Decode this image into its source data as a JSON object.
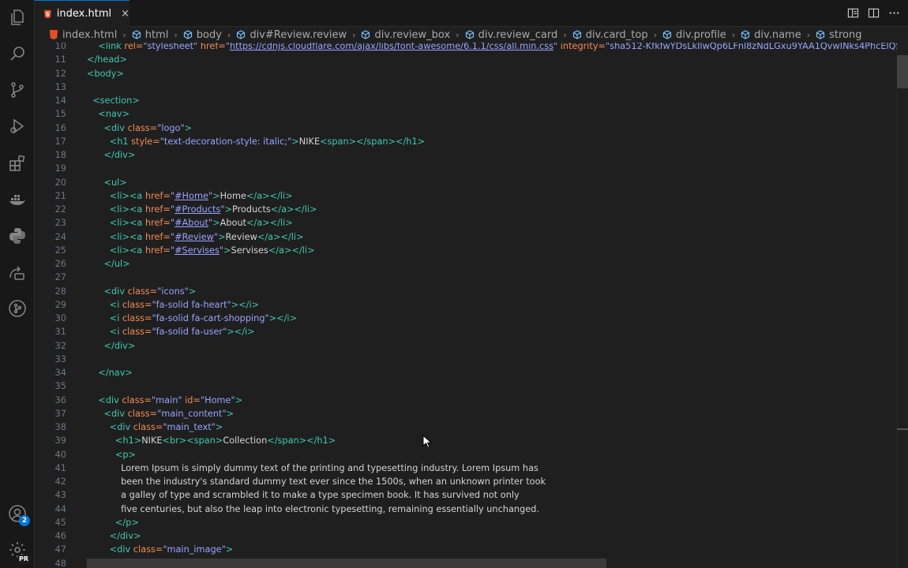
{
  "activity_bar": {
    "items": [
      "explorer-icon",
      "search-icon",
      "source-control-icon",
      "run-debug-icon",
      "extensions-icon",
      "docker-icon",
      "python-icon",
      "remote-explorer-icon",
      "gitlens-icon"
    ],
    "accounts_badge": "2",
    "settings_badge": "PR"
  },
  "tabs": [
    {
      "label": "index.html",
      "close": "×"
    }
  ],
  "breadcrumb": [
    "index.html",
    "html",
    "body",
    "div#Review.review",
    "div.review_box",
    "div.review_card",
    "div.card_top",
    "div.profile",
    "div.name",
    "strong"
  ],
  "editor": {
    "line_numbers": [
      "10",
      "11",
      "12",
      "13",
      "14",
      "15",
      "16",
      "17",
      "18",
      "19",
      "20",
      "21",
      "22",
      "23",
      "24",
      "25",
      "26",
      "27",
      "28",
      "29",
      "30",
      "31",
      "32",
      "33",
      "34",
      "35",
      "36",
      "37",
      "38",
      "39",
      "40",
      "41",
      "42",
      "43",
      "44",
      "45",
      "46",
      "47",
      "48"
    ],
    "lines": [
      [
        {
          "t": "    "
        },
        {
          "c": "tag",
          "t": "<link "
        },
        {
          "c": "attr",
          "t": "rel="
        },
        {
          "c": "val",
          "t": "\"stylesheet\" "
        },
        {
          "c": "attr",
          "t": "href="
        },
        {
          "c": "val",
          "t": "\""
        },
        {
          "c": "link",
          "t": "https://cdnjs.cloudflare.com/ajax/libs/font-awesome/6.1.1/css/all.min.css"
        },
        {
          "c": "val",
          "t": "\" "
        },
        {
          "c": "attr",
          "t": "integrity="
        },
        {
          "c": "val",
          "t": "\"sha512-KfkfwYDsLkIlwQp6LFnl8zNdLGxu9YAA1QvwINks4PhcElQSvqcyVLLD"
        }
      ],
      [
        {
          "c": "tag",
          "t": "</head>"
        }
      ],
      [
        {
          "c": "tag",
          "t": "<body>"
        }
      ],
      [],
      [
        {
          "t": "  "
        },
        {
          "c": "tag",
          "t": "<section>"
        }
      ],
      [
        {
          "t": "    "
        },
        {
          "c": "tag",
          "t": "<nav>"
        }
      ],
      [
        {
          "t": "      "
        },
        {
          "c": "tag",
          "t": "<div "
        },
        {
          "c": "attr",
          "t": "class="
        },
        {
          "c": "val",
          "t": "\"logo\""
        },
        {
          "c": "tag",
          "t": ">"
        }
      ],
      [
        {
          "t": "        "
        },
        {
          "c": "tag",
          "t": "<h1 "
        },
        {
          "c": "attr",
          "t": "style="
        },
        {
          "c": "val",
          "t": "\"text-decoration-style: italic;\""
        },
        {
          "c": "tag",
          "t": ">"
        },
        {
          "c": "txt",
          "t": "NIKE"
        },
        {
          "c": "tag",
          "t": "<span></span></h1>"
        }
      ],
      [
        {
          "t": "      "
        },
        {
          "c": "tag",
          "t": "</div>"
        }
      ],
      [],
      [
        {
          "t": "      "
        },
        {
          "c": "tag",
          "t": "<ul>"
        }
      ],
      [
        {
          "t": "        "
        },
        {
          "c": "tag",
          "t": "<li><a "
        },
        {
          "c": "attr",
          "t": "href="
        },
        {
          "c": "val",
          "t": "\""
        },
        {
          "c": "link",
          "t": "#Home"
        },
        {
          "c": "val",
          "t": "\""
        },
        {
          "c": "tag",
          "t": ">"
        },
        {
          "c": "txt",
          "t": "Home"
        },
        {
          "c": "tag",
          "t": "</a></li>"
        }
      ],
      [
        {
          "t": "        "
        },
        {
          "c": "tag",
          "t": "<li><a "
        },
        {
          "c": "attr",
          "t": "href="
        },
        {
          "c": "val",
          "t": "\""
        },
        {
          "c": "link",
          "t": "#Products"
        },
        {
          "c": "val",
          "t": "\""
        },
        {
          "c": "tag",
          "t": ">"
        },
        {
          "c": "txt",
          "t": "Products"
        },
        {
          "c": "tag",
          "t": "</a></li>"
        }
      ],
      [
        {
          "t": "        "
        },
        {
          "c": "tag",
          "t": "<li><a "
        },
        {
          "c": "attr",
          "t": "href="
        },
        {
          "c": "val",
          "t": "\""
        },
        {
          "c": "link",
          "t": "#About"
        },
        {
          "c": "val",
          "t": "\""
        },
        {
          "c": "tag",
          "t": ">"
        },
        {
          "c": "txt",
          "t": "About"
        },
        {
          "c": "tag",
          "t": "</a></li>"
        }
      ],
      [
        {
          "t": "        "
        },
        {
          "c": "tag",
          "t": "<li><a "
        },
        {
          "c": "attr",
          "t": "href="
        },
        {
          "c": "val",
          "t": "\""
        },
        {
          "c": "link",
          "t": "#Review"
        },
        {
          "c": "val",
          "t": "\""
        },
        {
          "c": "tag",
          "t": ">"
        },
        {
          "c": "txt",
          "t": "Review"
        },
        {
          "c": "tag",
          "t": "</a></li>"
        }
      ],
      [
        {
          "t": "        "
        },
        {
          "c": "tag",
          "t": "<li><a "
        },
        {
          "c": "attr",
          "t": "href="
        },
        {
          "c": "val",
          "t": "\""
        },
        {
          "c": "link",
          "t": "#Servises"
        },
        {
          "c": "val",
          "t": "\""
        },
        {
          "c": "tag",
          "t": ">"
        },
        {
          "c": "txt",
          "t": "Servises"
        },
        {
          "c": "tag",
          "t": "</a></li>"
        }
      ],
      [
        {
          "t": "      "
        },
        {
          "c": "tag",
          "t": "</ul>"
        }
      ],
      [],
      [
        {
          "t": "      "
        },
        {
          "c": "tag",
          "t": "<div "
        },
        {
          "c": "attr",
          "t": "class="
        },
        {
          "c": "val",
          "t": "\"icons\""
        },
        {
          "c": "tag",
          "t": ">"
        }
      ],
      [
        {
          "t": "        "
        },
        {
          "c": "tag",
          "t": "<i "
        },
        {
          "c": "attr",
          "t": "class="
        },
        {
          "c": "val",
          "t": "\"fa-solid fa-heart\""
        },
        {
          "c": "tag",
          "t": "></i>"
        }
      ],
      [
        {
          "t": "        "
        },
        {
          "c": "tag",
          "t": "<i "
        },
        {
          "c": "attr",
          "t": "class="
        },
        {
          "c": "val",
          "t": "\"fa-solid fa-cart-shopping\""
        },
        {
          "c": "tag",
          "t": "></i>"
        }
      ],
      [
        {
          "t": "        "
        },
        {
          "c": "tag",
          "t": "<i "
        },
        {
          "c": "attr",
          "t": "class="
        },
        {
          "c": "val",
          "t": "\"fa-solid fa-user\""
        },
        {
          "c": "tag",
          "t": "></i>"
        }
      ],
      [
        {
          "t": "      "
        },
        {
          "c": "tag",
          "t": "</div>"
        }
      ],
      [],
      [
        {
          "t": "    "
        },
        {
          "c": "tag",
          "t": "</nav>"
        }
      ],
      [],
      [
        {
          "t": "    "
        },
        {
          "c": "tag",
          "t": "<div "
        },
        {
          "c": "attr",
          "t": "class="
        },
        {
          "c": "val",
          "t": "\"main\" "
        },
        {
          "c": "attr",
          "t": "id="
        },
        {
          "c": "val",
          "t": "\"Home\""
        },
        {
          "c": "tag",
          "t": ">"
        }
      ],
      [
        {
          "t": "      "
        },
        {
          "c": "tag",
          "t": "<div "
        },
        {
          "c": "attr",
          "t": "class="
        },
        {
          "c": "val",
          "t": "\"main_content\""
        },
        {
          "c": "tag",
          "t": ">"
        }
      ],
      [
        {
          "t": "        "
        },
        {
          "c": "tag",
          "t": "<div "
        },
        {
          "c": "attr",
          "t": "class="
        },
        {
          "c": "val",
          "t": "\"main_text\""
        },
        {
          "c": "tag",
          "t": ">"
        }
      ],
      [
        {
          "t": "          "
        },
        {
          "c": "tag",
          "t": "<h1>"
        },
        {
          "c": "txt",
          "t": "NIKE"
        },
        {
          "c": "tag",
          "t": "<br><span>"
        },
        {
          "c": "txt",
          "t": "Collection"
        },
        {
          "c": "tag",
          "t": "</span></h1>"
        }
      ],
      [
        {
          "t": "          "
        },
        {
          "c": "tag",
          "t": "<p>"
        }
      ],
      [
        {
          "t": "            "
        },
        {
          "c": "txt",
          "t": "Lorem Ipsum is simply dummy text of the printing and typesetting industry. Lorem Ipsum has"
        }
      ],
      [
        {
          "t": "            "
        },
        {
          "c": "txt",
          "t": "been the industry's standard dummy text ever since the 1500s, when an unknown printer took"
        }
      ],
      [
        {
          "t": "            "
        },
        {
          "c": "txt",
          "t": "a galley of type and scrambled it to make a type specimen book. It has survived not only"
        }
      ],
      [
        {
          "t": "            "
        },
        {
          "c": "txt",
          "t": "five centuries, but also the leap into electronic typesetting, remaining essentially unchanged."
        }
      ],
      [
        {
          "t": "          "
        },
        {
          "c": "tag",
          "t": "</p>"
        }
      ],
      [
        {
          "t": "        "
        },
        {
          "c": "tag",
          "t": "</div>"
        }
      ],
      [
        {
          "t": "        "
        },
        {
          "c": "tag",
          "t": "<div "
        },
        {
          "c": "attr",
          "t": "class="
        },
        {
          "c": "val",
          "t": "\"main_image\""
        },
        {
          "c": "tag",
          "t": ">"
        }
      ],
      [
        {
          "t": "          "
        },
        {
          "c": "tag",
          "t": "<img "
        },
        {
          "c": "attr",
          "t": "src="
        },
        {
          "c": "val",
          "t": "\"image/shoes.png\""
        },
        {
          "c": "tag",
          "t": ">"
        }
      ]
    ]
  },
  "colors": {
    "tag": "#3dc9b0",
    "attribute": "#f28b54",
    "value": "#9aa3ff",
    "text": "#d4d4d4",
    "accent": "#0078d4"
  }
}
